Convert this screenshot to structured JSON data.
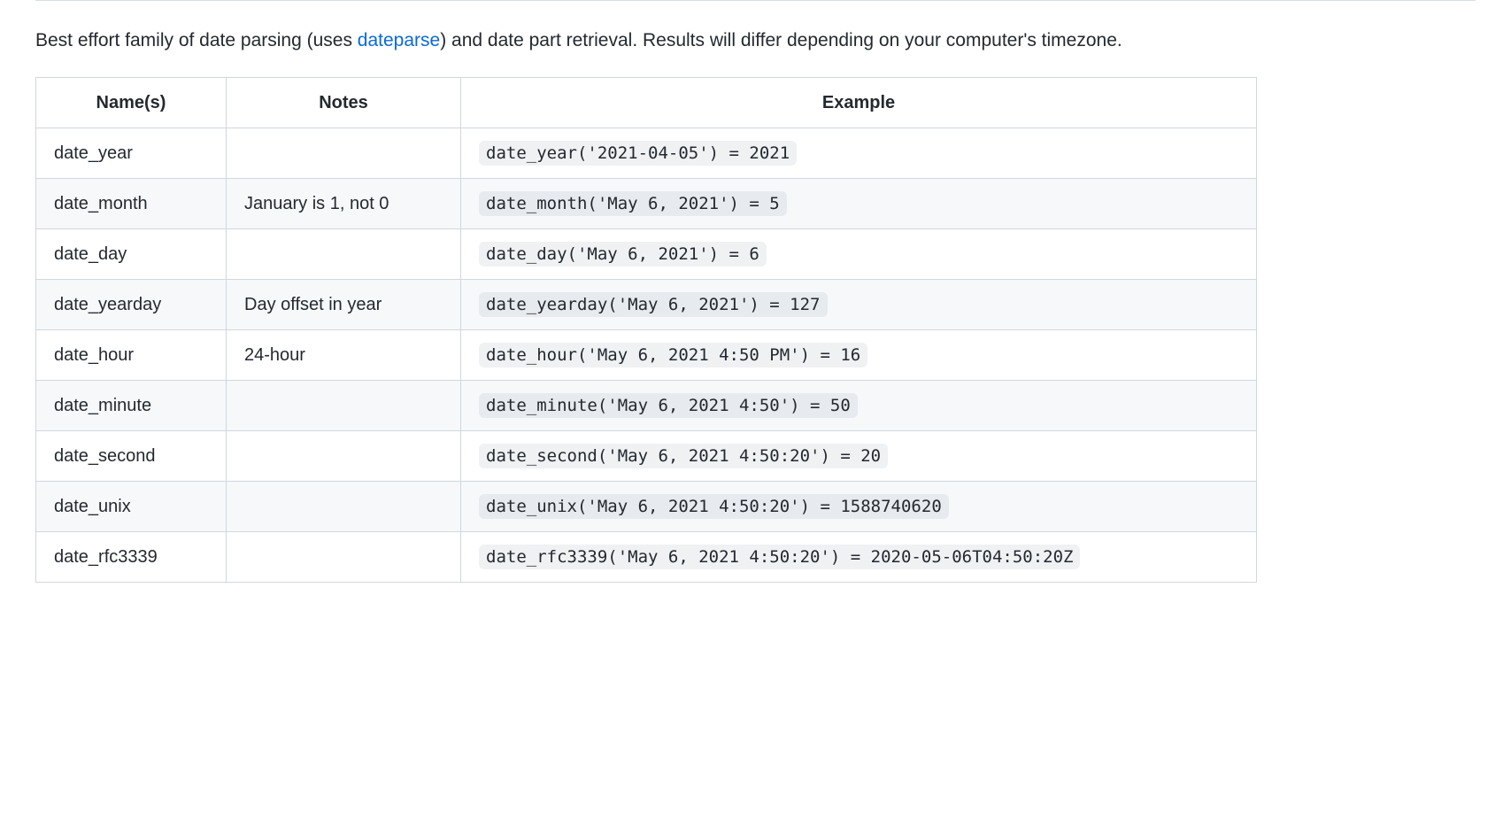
{
  "intro": {
    "prefix": "Best effort family of date parsing (uses ",
    "link_text": "dateparse",
    "suffix": ") and date part retrieval. Results will differ depending on your computer's timezone."
  },
  "table": {
    "headers": [
      "Name(s)",
      "Notes",
      "Example"
    ],
    "rows": [
      {
        "name": "date_year",
        "notes": "",
        "example": "date_year('2021-04-05') = 2021"
      },
      {
        "name": "date_month",
        "notes": "January is 1, not 0",
        "example": "date_month('May 6, 2021') = 5"
      },
      {
        "name": "date_day",
        "notes": "",
        "example": "date_day('May 6, 2021') = 6"
      },
      {
        "name": "date_yearday",
        "notes": "Day offset in year",
        "example": "date_yearday('May 6, 2021') = 127"
      },
      {
        "name": "date_hour",
        "notes": "24-hour",
        "example": "date_hour('May 6, 2021 4:50 PM') = 16"
      },
      {
        "name": "date_minute",
        "notes": "",
        "example": "date_minute('May 6, 2021 4:50') = 50"
      },
      {
        "name": "date_second",
        "notes": "",
        "example": "date_second('May 6, 2021 4:50:20') = 20"
      },
      {
        "name": "date_unix",
        "notes": "",
        "example": "date_unix('May 6, 2021 4:50:20') = 1588740620"
      },
      {
        "name": "date_rfc3339",
        "notes": "",
        "example": "date_rfc3339('May 6, 2021 4:50:20') = 2020-05-06T04:50:20Z"
      }
    ]
  }
}
